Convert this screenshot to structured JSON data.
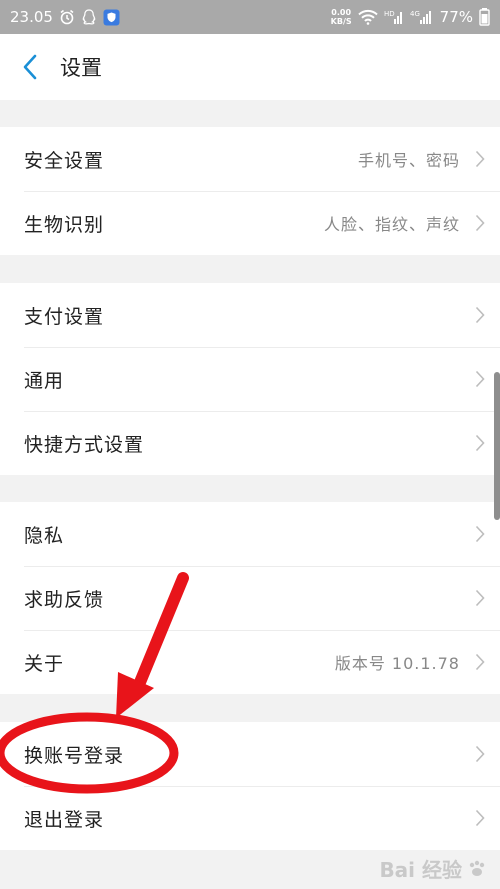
{
  "status_bar": {
    "time": "23.05",
    "net_speed_value": "0.00",
    "net_speed_unit": "KB/S",
    "battery": "77%"
  },
  "header": {
    "title": "设置"
  },
  "groups": [
    {
      "items": [
        {
          "label": "安全设置",
          "value": "手机号、密码"
        },
        {
          "label": "生物识别",
          "value": "人脸、指纹、声纹"
        }
      ]
    },
    {
      "items": [
        {
          "label": "支付设置"
        },
        {
          "label": "通用"
        },
        {
          "label": "快捷方式设置"
        }
      ]
    },
    {
      "items": [
        {
          "label": "隐私"
        },
        {
          "label": "求助反馈"
        },
        {
          "label": "关于",
          "value": "版本号 10.1.78"
        }
      ]
    },
    {
      "items": [
        {
          "label": "换账号登录"
        },
        {
          "label": "退出登录"
        }
      ]
    }
  ],
  "annotation_color": "#e8141a",
  "watermark": {
    "text": "Bai 经验"
  }
}
